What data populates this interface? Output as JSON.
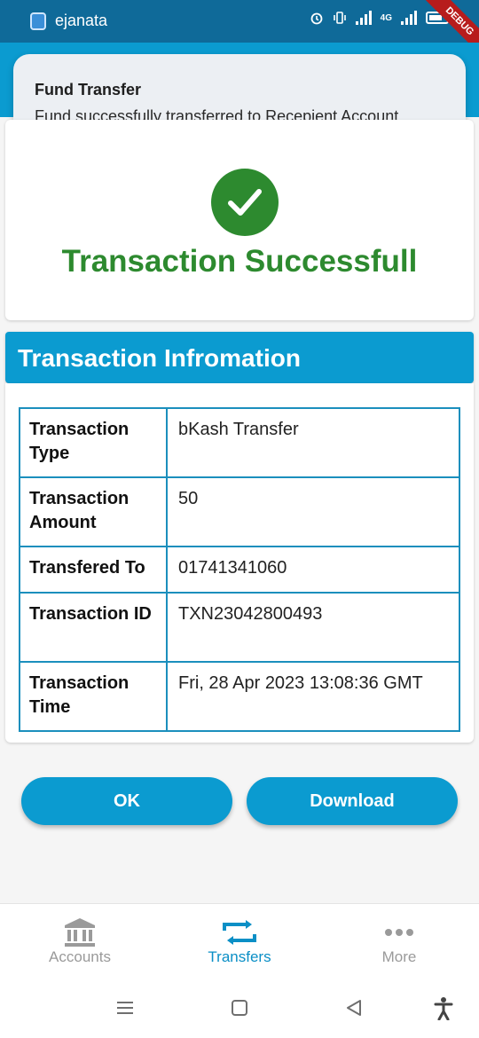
{
  "status_bar": {
    "app_name": "ejanata",
    "network_label": "4G",
    "debug_label": "DEBUG"
  },
  "notification": {
    "title": "Fund Transfer",
    "body": "Fund successfully transferred to Recepient Account"
  },
  "result": {
    "message": "Transaction Successfull",
    "status_color": "#2d8a2f"
  },
  "info_section": {
    "title": "Transaction Infromation",
    "rows": [
      {
        "label": "Transaction Type",
        "value": "bKash Transfer"
      },
      {
        "label": "Transaction Amount",
        "value": "50"
      },
      {
        "label": "Transfered To",
        "value": "01741341060"
      },
      {
        "label": "Transaction ID",
        "value": "TXN23042800493"
      },
      {
        "label": "Transaction Time",
        "value": "Fri, 28 Apr 2023 13:08:36 GMT"
      }
    ]
  },
  "actions": {
    "ok_label": "OK",
    "download_label": "Download"
  },
  "bottom_nav": {
    "items": [
      {
        "label": "Accounts",
        "icon": "bank-icon",
        "active": false
      },
      {
        "label": "Transfers",
        "icon": "transfer-arrows-icon",
        "active": true
      },
      {
        "label": "More",
        "icon": "more-dots-icon",
        "active": false
      }
    ]
  },
  "colors": {
    "primary": "#0b9bd0",
    "status_bar": "#0f6a99",
    "success": "#2d8a2f",
    "nav_active": "#0b8fc6",
    "nav_inactive": "#9a9a9a"
  }
}
